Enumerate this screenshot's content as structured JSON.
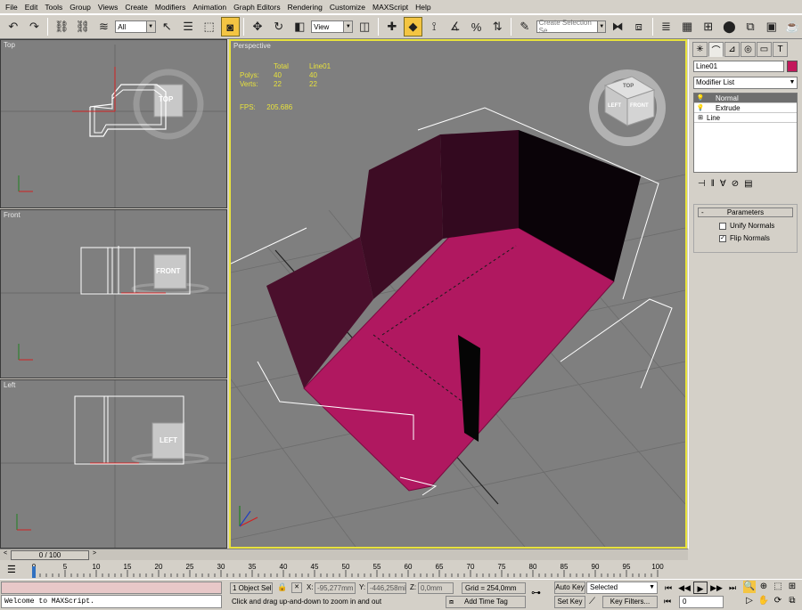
{
  "menu": [
    "File",
    "Edit",
    "Tools",
    "Group",
    "Views",
    "Create",
    "Modifiers",
    "Animation",
    "Graph Editors",
    "Rendering",
    "Customize",
    "MAXScript",
    "Help"
  ],
  "toolbar": {
    "selection_filter": "All",
    "ref_coord": "View",
    "named_selection_placeholder": "Create Selection Se"
  },
  "viewports": {
    "top": {
      "label": "Top",
      "cube": "TOP"
    },
    "front": {
      "label": "Front",
      "cube": "FRONT"
    },
    "left": {
      "label": "Left",
      "cube": "LEFT"
    },
    "perspective": {
      "label": "Perspective",
      "stats_header": {
        "total": "Total",
        "object": "Line01"
      },
      "polys": {
        "label": "Polys:",
        "total": "40",
        "object": "40"
      },
      "verts": {
        "label": "Verts:",
        "total": "22",
        "object": "22"
      },
      "fps": {
        "label": "FPS:",
        "value": "205.686"
      },
      "cube_left": "LEFT",
      "cube_front": "FRONT",
      "cube_top": "TOP"
    }
  },
  "command_panel": {
    "object_name": "Line01",
    "object_color": "#c2185b",
    "modifier_list": "Modifier List",
    "stack": [
      {
        "label": "Normal",
        "selected": true
      },
      {
        "label": "Extrude",
        "selected": false
      },
      {
        "label": "Line",
        "selected": false
      }
    ],
    "rollout_title": "Parameters",
    "rollout_toggle": "-",
    "unify_normals": {
      "label": "Unify Normals",
      "checked": false
    },
    "flip_normals": {
      "label": "Flip Normals",
      "checked": true
    }
  },
  "time_slider": {
    "label": "0 / 100"
  },
  "track_ticks": [
    "0",
    "5",
    "10",
    "15",
    "20",
    "25",
    "30",
    "35",
    "40",
    "45",
    "50",
    "55",
    "60",
    "65",
    "70",
    "75",
    "80",
    "85",
    "90",
    "95",
    "100"
  ],
  "status": {
    "listener": "Welcome to MAXScript.",
    "selection_count": "1 Object Sele",
    "x_label": "X:",
    "x_value": "-95,277mm",
    "y_label": "Y:",
    "y_value": "-446,258mi",
    "z_label": "Z:",
    "z_value": "0,0mm",
    "grid": "Grid = 254,0mm",
    "prompt": "Click and drag up-and-down to zoom in and out",
    "add_time_tag": "Add Time Tag",
    "auto_key": "Auto Key",
    "set_key": "Set Key",
    "key_mode": "Selected",
    "key_filters": "Key Filters...",
    "frame": "0"
  },
  "colors": {
    "mesh_face": "#b01860",
    "mesh_wall": "#3a0a20",
    "viewport_bg": "#7f7f7f",
    "active_border": "#e8e23c"
  }
}
